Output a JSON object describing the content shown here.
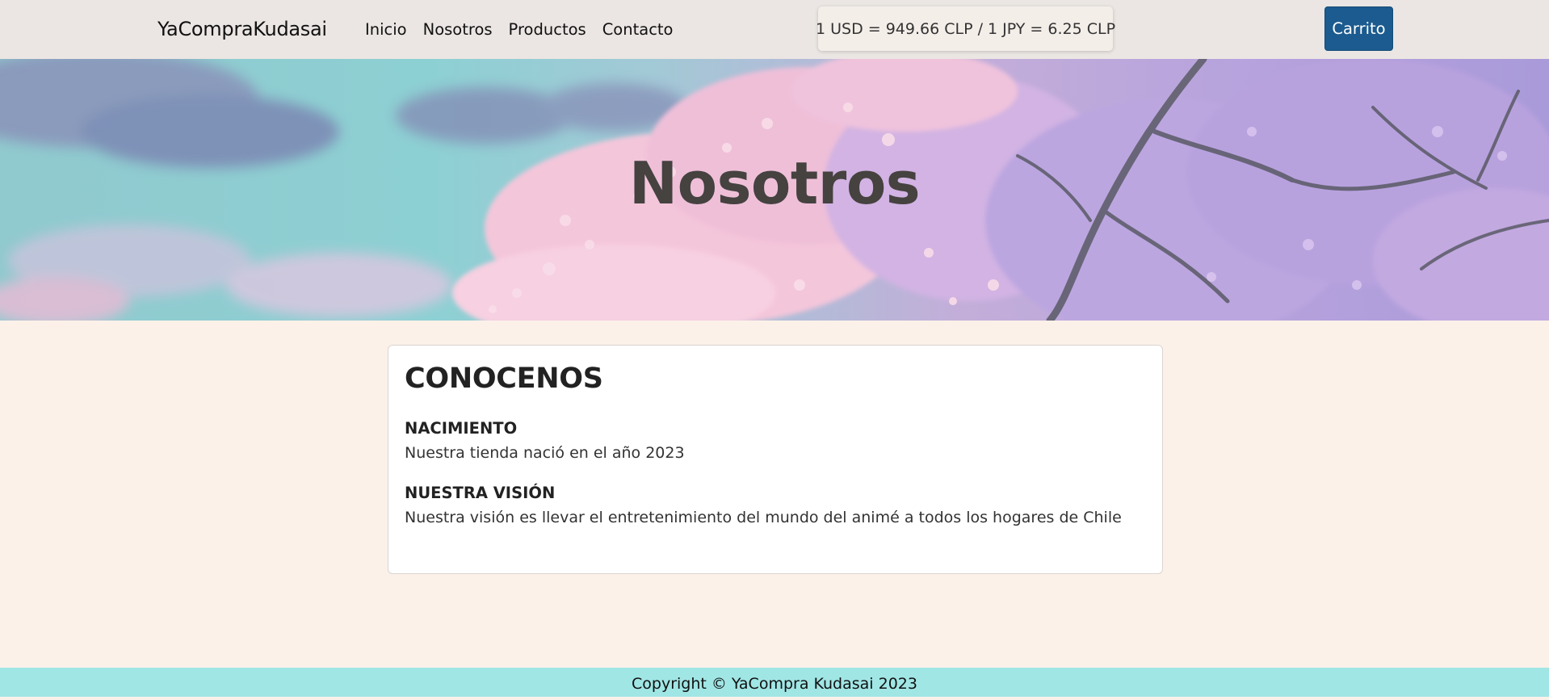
{
  "navbar": {
    "brand": "YaCompraKudasai",
    "links": [
      "Inicio",
      "Nosotros",
      "Productos",
      "Contacto"
    ],
    "exchange_rate": "1 USD = 949.66 CLP / 1 JPY = 6.25 CLP",
    "cart_label": "Carrito"
  },
  "hero": {
    "title": "Nosotros"
  },
  "card": {
    "title": "CONOCENOS",
    "sections": [
      {
        "heading": "NACIMIENTO",
        "text": "Nuestra tienda nació en el año 2023"
      },
      {
        "heading": "NUESTRA VISIÓN",
        "text": "Nuestra visión es llevar el entretenimiento del mundo del animé a todos los hogares de Chile"
      }
    ]
  },
  "footer": {
    "text": "Copyright © YaCompra Kudasai 2023"
  },
  "colors": {
    "navbar_bg": "#ebe6e3",
    "cart_button": "#1b5b8f",
    "page_bg": "#fbf1e9",
    "footer_bg": "#a0e6e5"
  }
}
